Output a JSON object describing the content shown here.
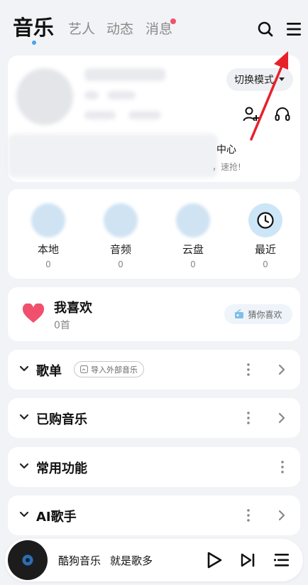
{
  "header": {
    "tabs": [
      {
        "label": "音乐",
        "active": true
      },
      {
        "label": "艺人",
        "active": false
      },
      {
        "label": "动态",
        "active": false
      },
      {
        "label": "消息",
        "active": false,
        "badge": true
      }
    ],
    "search_icon": "search-icon",
    "menu_icon": "menu-icon"
  },
  "profile": {
    "switch_mode_label": "切换模式",
    "vip_title": "中心",
    "vip_subtitle": "，速抢!"
  },
  "quick_access": [
    {
      "label": "本地",
      "count": "0"
    },
    {
      "label": "音频",
      "count": "0"
    },
    {
      "label": "云盘",
      "count": "0"
    },
    {
      "label": "最近",
      "count": "0"
    }
  ],
  "favorites": {
    "title": "我喜欢",
    "count": "0首",
    "guess_label": "猜你喜欢"
  },
  "sections": {
    "playlist": {
      "title": "歌单",
      "import_label": "导入外部音乐"
    },
    "purchased": {
      "title": "已购音乐"
    },
    "tools": {
      "title": "常用功能"
    },
    "ai_singer": {
      "title": "AI歌手"
    }
  },
  "player": {
    "song": "酷狗音乐",
    "artist": "就是歌多"
  },
  "colors": {
    "accent": "#4aa3ef",
    "heart": "#f0506e",
    "annotation_arrow": "#e8202a"
  }
}
